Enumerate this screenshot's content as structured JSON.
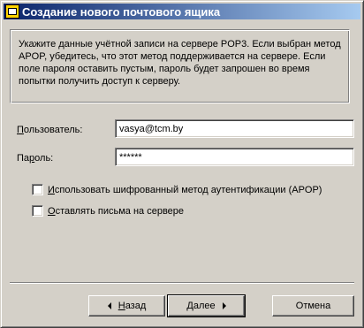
{
  "window": {
    "title": "Создание нового почтового ящика",
    "icon": "mailbox-icon"
  },
  "info": {
    "text": "Укажите данные учётной записи на сервере POP3. Если выбран метод APOP, убедитесь, что этот метод поддерживается на сервере. Если поле пароля оставить пустым, пароль будет запрошен во время попытки получить доступ к серверу."
  },
  "form": {
    "user_label_prefix": "",
    "user_label_accel": "П",
    "user_label_rest": "ользователь:",
    "user_value": "vasya@tcm.by",
    "password_label_prefix": "Па",
    "password_label_accel": "р",
    "password_label_rest": "оль:",
    "password_value": "******",
    "apop_accel": "И",
    "apop_rest": "спользовать шифрованный метод аутентификации (APOP)",
    "apop_checked": false,
    "leave_accel": "О",
    "leave_rest": "ставлять письма на сервере",
    "leave_checked": false
  },
  "buttons": {
    "back_accel": "Н",
    "back_rest": "азад",
    "next_accel": "Д",
    "next_rest": "алее",
    "cancel_label": "Отмена"
  }
}
